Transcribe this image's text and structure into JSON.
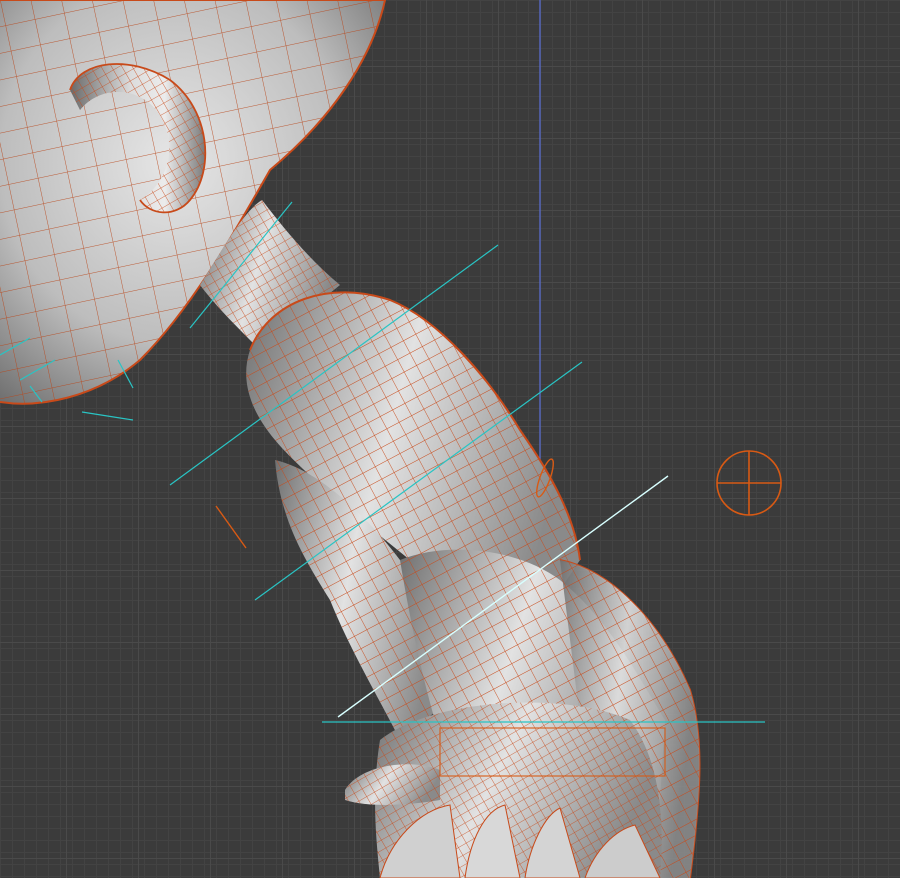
{
  "viewport": {
    "background": "#3b3b3b",
    "grid_minor": "#434343",
    "grid_major": "#4a4a4a",
    "axis_color": "#5a6fd8"
  },
  "mesh": {
    "surface_light": "#e4e4e4",
    "surface_dark": "#6a6a6a",
    "wire_color": "#c84a1a",
    "rig_helper_color": "#29c4c4",
    "ik_line_color": "#d8ffff",
    "locator_color": "#d85a14"
  },
  "icons": {
    "locator": "crosshair-circle"
  }
}
